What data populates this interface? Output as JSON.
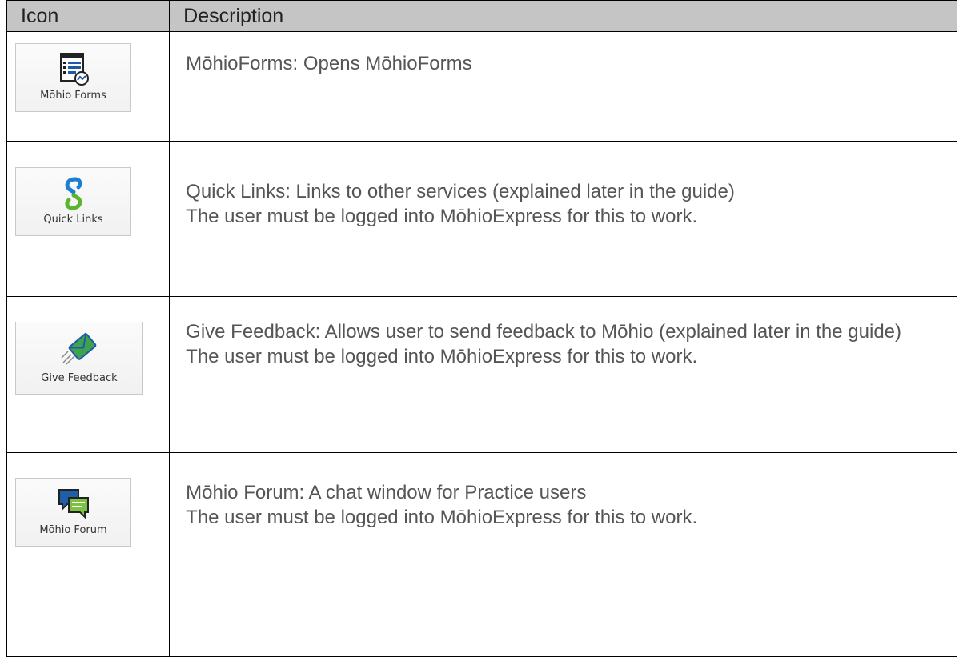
{
  "table": {
    "headers": {
      "icon": "Icon",
      "description": "Description"
    },
    "rows": [
      {
        "icon_name": "mohio-forms-icon",
        "icon_label": "Mōhio Forms",
        "lines": [
          "MōhioForms: Opens MōhioForms"
        ]
      },
      {
        "icon_name": "quick-links-icon",
        "icon_label": "Quick  Links",
        "lines": [
          "Quick Links: Links to other services (explained later in the guide)",
          "The user must be logged into MōhioExpress for this to work."
        ]
      },
      {
        "icon_name": "give-feedback-icon",
        "icon_label": "Give Feedback",
        "lines": [
          "Give Feedback: Allows user to send feedback to Mōhio (explained later in the guide)",
          "The user must be logged into MōhioExpress for this to work."
        ]
      },
      {
        "icon_name": "mohio-forum-icon",
        "icon_label": "Mōhio Forum",
        "lines": [
          "Mōhio Forum: A chat window for Practice users",
          "The user must be logged into MōhioExpress for this to work."
        ]
      }
    ]
  },
  "colors": {
    "header_bg": "#c5c5c5",
    "text": "#555555",
    "forms_blue": "#1e5aa8",
    "links_blue": "#1d7fd0",
    "links_green": "#5bb532",
    "feedback_green": "#3fa34d",
    "forum_blue": "#1f5fa8",
    "forum_green": "#7cc142"
  }
}
